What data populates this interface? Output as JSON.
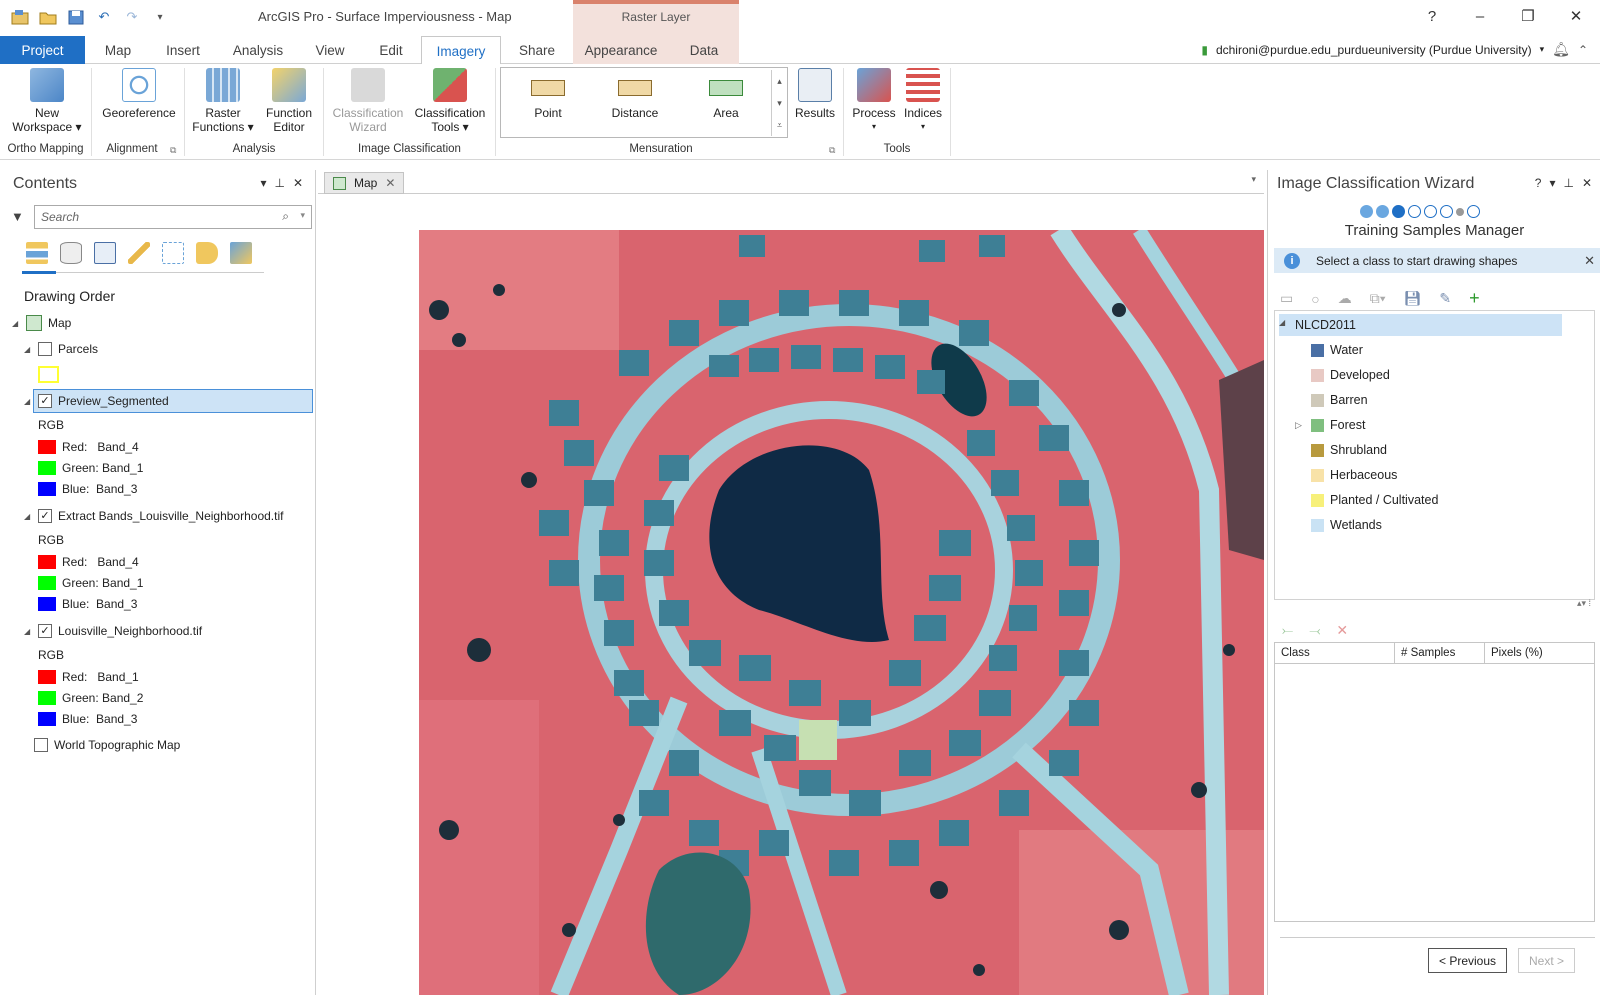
{
  "app": {
    "title": "ArcGIS Pro - Surface Imperviousness - Map",
    "context_tab_header": "Raster Layer",
    "help": "?",
    "qat_undo": "↶",
    "qat_redo": "↷"
  },
  "tabs": [
    {
      "label": "Project"
    },
    {
      "label": "Map"
    },
    {
      "label": "Insert"
    },
    {
      "label": "Analysis"
    },
    {
      "label": "View"
    },
    {
      "label": "Edit"
    },
    {
      "label": "Imagery"
    },
    {
      "label": "Share"
    },
    {
      "label": "Appearance"
    },
    {
      "label": "Data"
    }
  ],
  "user": {
    "name": "dchironi@purdue.edu_purdueuniversity (Purdue University)"
  },
  "ribbon": {
    "new_workspace": "New\nWorkspace ▾",
    "new_workspace_l1": "New",
    "new_workspace_l2": "Workspace ▾",
    "georeference": "Georeference",
    "raster_functions_l1": "Raster",
    "raster_functions_l2": "Functions ▾",
    "function_editor_l1": "Function",
    "function_editor_l2": "Editor",
    "classification_wizard_l1": "Classification",
    "classification_wizard_l2": "Wizard",
    "classification_tools_l1": "Classification",
    "classification_tools_l2": "Tools ▾",
    "point": "Point",
    "distance": "Distance",
    "area": "Area",
    "results": "Results",
    "process": "Process",
    "indices": "Indices",
    "groups": {
      "ortho": "Ortho Mapping",
      "alignment": "Alignment",
      "analysis": "Analysis",
      "image_classification": "Image Classification",
      "mensuration": "Mensuration",
      "tools": "Tools"
    }
  },
  "contents": {
    "title": "Contents",
    "search_placeholder": "Search",
    "drawing_order": "Drawing Order",
    "map_label": "Map",
    "parcels": "Parcels",
    "preview_segmented": "Preview_Segmented",
    "extract_bands": "Extract Bands_Louisville_Neighborhood.tif",
    "louisville": "Louisville_Neighborhood.tif",
    "world_topo": "World Topographic Map",
    "rgb": "RGB",
    "preview_bands": [
      "Red:   Band_4",
      "Green: Band_1",
      "Blue:  Band_3"
    ],
    "extract_bands_list": [
      "Red:   Band_4",
      "Green: Band_1",
      "Blue:  Band_3"
    ],
    "louisville_bands": [
      "Red:   Band_1",
      "Green: Band_2",
      "Blue:  Band_3"
    ],
    "colors": {
      "red": "#ff0000",
      "green": "#00ff00",
      "blue": "#0000ff",
      "parcel_outline": "#ffff33"
    }
  },
  "map": {
    "tab_label": "Map"
  },
  "wizard": {
    "title": "Image Classification Wizard",
    "subtitle": "Training Samples Manager",
    "info_message": "Select a class to start drawing shapes",
    "schema_root": "NLCD2011",
    "classes": [
      {
        "name": "Water",
        "color": "#4a6fa5"
      },
      {
        "name": "Developed",
        "color": "#e8c9c4"
      },
      {
        "name": "Barren",
        "color": "#cfc9b9"
      },
      {
        "name": "Forest",
        "color": "#7fbf7f"
      },
      {
        "name": "Shrubland",
        "color": "#b89a3e"
      },
      {
        "name": "Herbaceous",
        "color": "#f8e2a8"
      },
      {
        "name": "Planted / Cultivated",
        "color": "#f7f07a"
      },
      {
        "name": "Wetlands",
        "color": "#c9e2f4"
      }
    ],
    "table_headers": [
      "Class",
      "# Samples",
      "Pixels (%)"
    ],
    "prev_button": "< Previous",
    "next_button": "Next >"
  }
}
